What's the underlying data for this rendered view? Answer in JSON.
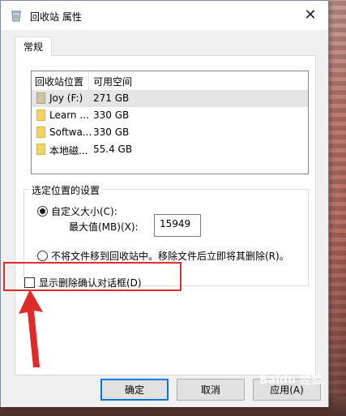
{
  "window": {
    "title": "回收站 属性",
    "close_glyph": "✕"
  },
  "tabs": [
    {
      "label": "常规"
    }
  ],
  "list": {
    "headers": [
      "回收站位置",
      "可用空间"
    ],
    "rows": [
      {
        "name": "Joy (F:)",
        "space": "271 GB",
        "icon": "drive-icon"
      },
      {
        "name": "Learn ...",
        "space": "330 GB",
        "icon": "folder-icon"
      },
      {
        "name": "Softwa...",
        "space": "330 GB",
        "icon": "folder-icon"
      },
      {
        "name": "本地磁...",
        "space": "55.4 GB",
        "icon": "folder-icon"
      }
    ]
  },
  "settings": {
    "legend": "选定位置的设置",
    "custom_size_label": "自定义大小(C):",
    "max_label": "最大值(MB)(X):",
    "max_value": "15949",
    "no_recycle_label": "不将文件移到回收站中。移除文件后立即将其删除(R)。"
  },
  "confirm_checkbox_label": "显示删除确认对话框(D)",
  "buttons": {
    "ok": "确定",
    "cancel": "取消",
    "apply": "应用(A)"
  },
  "watermark": "Baidu 经验",
  "colors": {
    "highlight": "#e02b2b",
    "accent": "#0078d7"
  }
}
